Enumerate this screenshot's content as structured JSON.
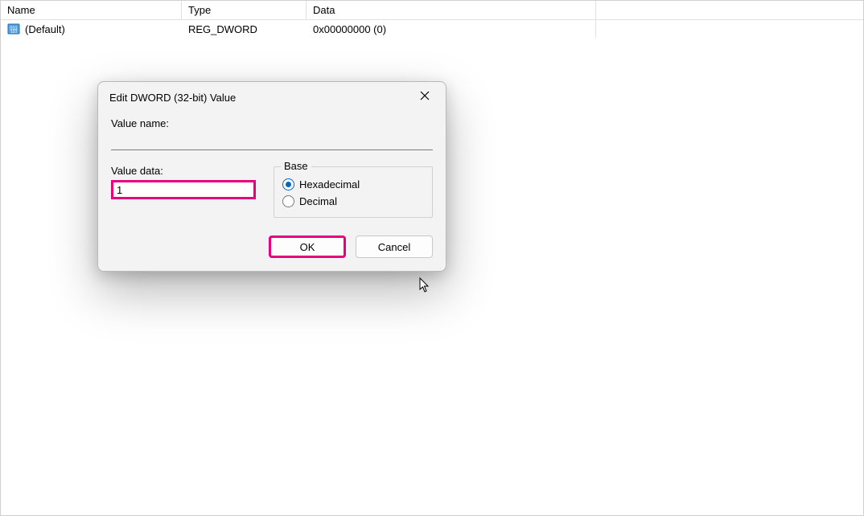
{
  "table": {
    "headers": {
      "name": "Name",
      "type": "Type",
      "data": "Data"
    },
    "rows": [
      {
        "name": "(Default)",
        "type": "REG_DWORD",
        "data": "0x00000000 (0)"
      }
    ]
  },
  "dialog": {
    "title": "Edit DWORD (32-bit) Value",
    "value_name_label": "Value name:",
    "value_name_value": "",
    "value_data_label": "Value data:",
    "value_data_value": "1",
    "base": {
      "legend": "Base",
      "hex_label": "Hexadecimal",
      "dec_label": "Decimal",
      "selected": "hex"
    },
    "ok_label": "OK",
    "cancel_label": "Cancel"
  },
  "highlight_color": "#e6007e"
}
